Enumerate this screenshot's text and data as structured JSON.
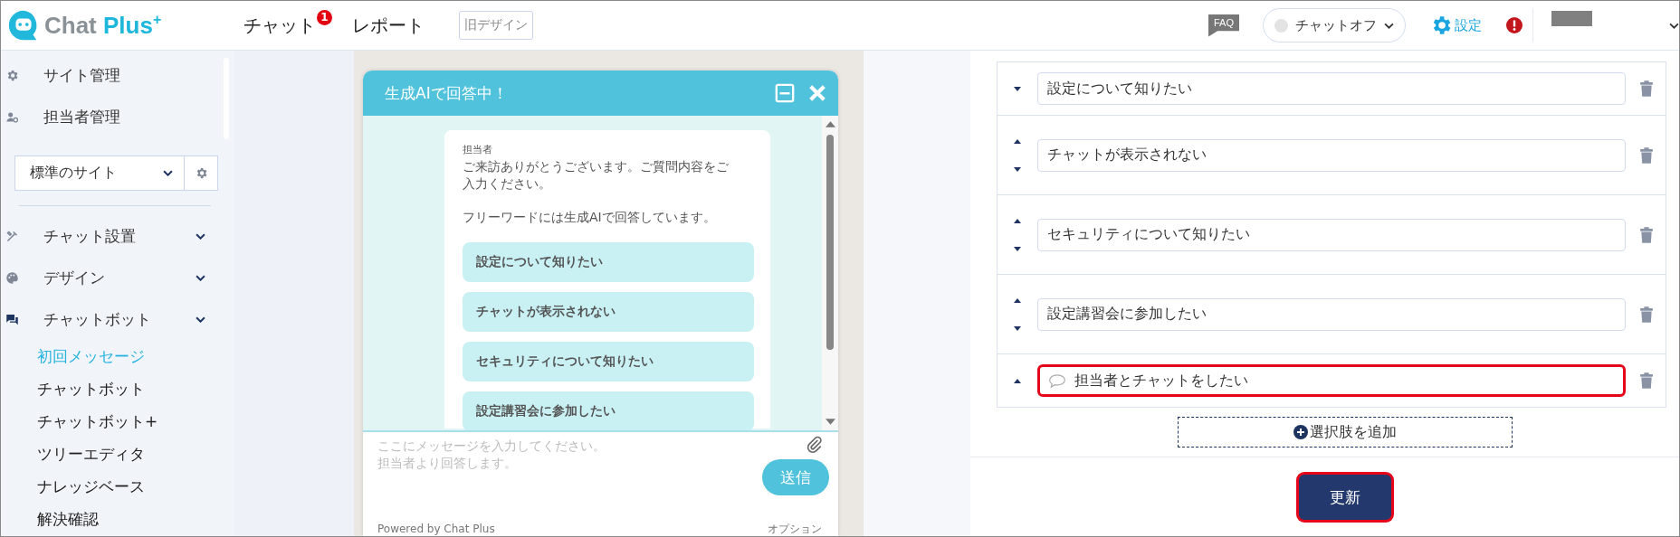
{
  "header": {
    "logo": {
      "word": "Chat",
      "accent": "Plus",
      "mark": "+"
    },
    "nav": [
      {
        "label": "チャット",
        "badge": "1"
      },
      {
        "label": "レポート"
      }
    ],
    "old_design_button": "旧デザイン",
    "faq": "FAQ",
    "chat_status": {
      "label": "チャットオフ",
      "on": false
    },
    "settings": "設定"
  },
  "sidebar": {
    "top_items": [
      {
        "label": "サイト管理"
      },
      {
        "label": "担当者管理"
      }
    ],
    "site_select": {
      "value": "標準のサイト"
    },
    "menu": [
      {
        "label": "チャット設置"
      },
      {
        "label": "デザイン"
      },
      {
        "label": "チャットボット",
        "children": [
          {
            "label": "初回メッセージ",
            "selected": true
          },
          {
            "label": "チャットボット",
            "selected": false
          },
          {
            "label": "チャットボット+",
            "selected": false
          },
          {
            "label": "ツリーエディタ",
            "selected": false
          },
          {
            "label": "ナレッジベース",
            "selected": false
          },
          {
            "label": "解決確認",
            "selected": false
          }
        ]
      }
    ]
  },
  "chat_widget": {
    "title": "生成AIで回答中！",
    "sender": "担当者",
    "message": [
      "ご来訪ありがとうございます。ご質問内容をご入力ください。",
      "フリーワードには生成AIで回答しています。"
    ],
    "options": [
      "設定について知りたい",
      "チャットが表示されない",
      "セキュリティについて知りたい",
      "設定講習会に参加したい"
    ],
    "input_placeholder": "ここにメッセージを入力してください。担当者より回答します。",
    "send_button": "送信",
    "footer_left": "Powered by Chat Plus",
    "footer_right": "オプション"
  },
  "choices": [
    {
      "kind": "choice",
      "text": "設定について知りたい",
      "can_move_up": false,
      "can_move_down": true,
      "highlighted": false
    },
    {
      "kind": "choice",
      "text": "チャットが表示されない",
      "can_move_up": true,
      "can_move_down": true,
      "highlighted": false
    },
    {
      "kind": "choice",
      "text": "セキュリティについて知りたい",
      "can_move_up": true,
      "can_move_down": true,
      "highlighted": false
    },
    {
      "kind": "choice",
      "text": "設定講習会に参加したい",
      "can_move_up": true,
      "can_move_down": true,
      "highlighted": false
    },
    {
      "kind": "operator",
      "text": "担当者とチャットをしたい",
      "can_move_up": true,
      "can_move_down": false,
      "highlighted": true
    }
  ],
  "add_button": "選択肢を追加",
  "update_button": {
    "label": "更新",
    "highlighted": true
  }
}
